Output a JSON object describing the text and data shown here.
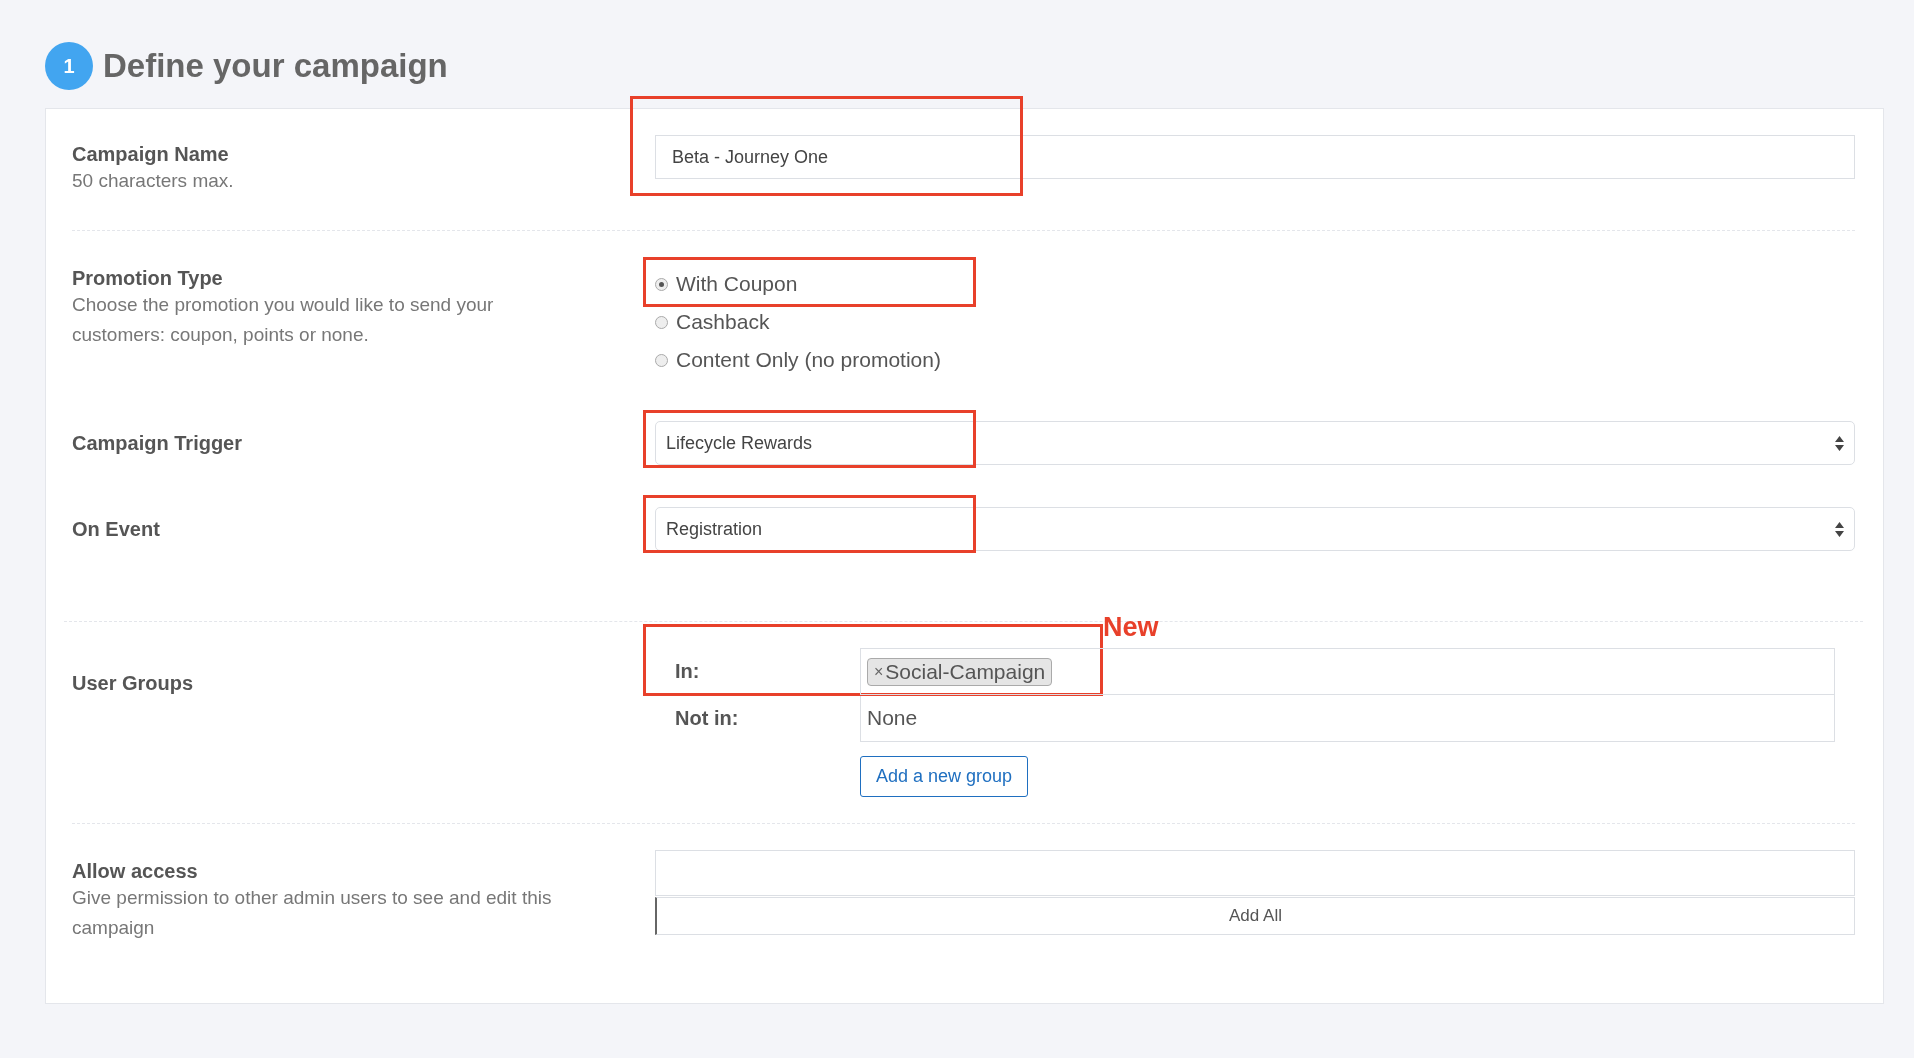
{
  "header": {
    "step": "1",
    "title": "Define your campaign"
  },
  "campaign_name": {
    "label": "Campaign Name",
    "hint": "50 characters max.",
    "value": "Beta - Journey One",
    "highlighted": true
  },
  "promotion_type": {
    "label": "Promotion Type",
    "hint": "Choose the promotion you would like to send your customers: coupon, points or none.",
    "options": [
      {
        "label": "With Coupon",
        "selected": true,
        "highlighted": true
      },
      {
        "label": "Cashback",
        "selected": false,
        "highlighted": false
      },
      {
        "label": "Content Only (no promotion)",
        "selected": false,
        "highlighted": false
      }
    ]
  },
  "campaign_trigger": {
    "label": "Campaign Trigger",
    "value": "Lifecycle Rewards",
    "highlighted": true
  },
  "on_event": {
    "label": "On Event",
    "value": "Registration",
    "highlighted": true
  },
  "user_groups": {
    "label": "User Groups",
    "in_label": "In:",
    "in_tags": [
      "Social-Campaign"
    ],
    "tag_remove": "×",
    "highlighted": true,
    "annotation": "New",
    "not_in_label": "Not in:",
    "not_in_value": "None",
    "add_button": "Add a new group"
  },
  "allow_access": {
    "label": "Allow access",
    "hint": "Give permission to other admin users to see and edit this campaign",
    "add_all": "Add All"
  }
}
